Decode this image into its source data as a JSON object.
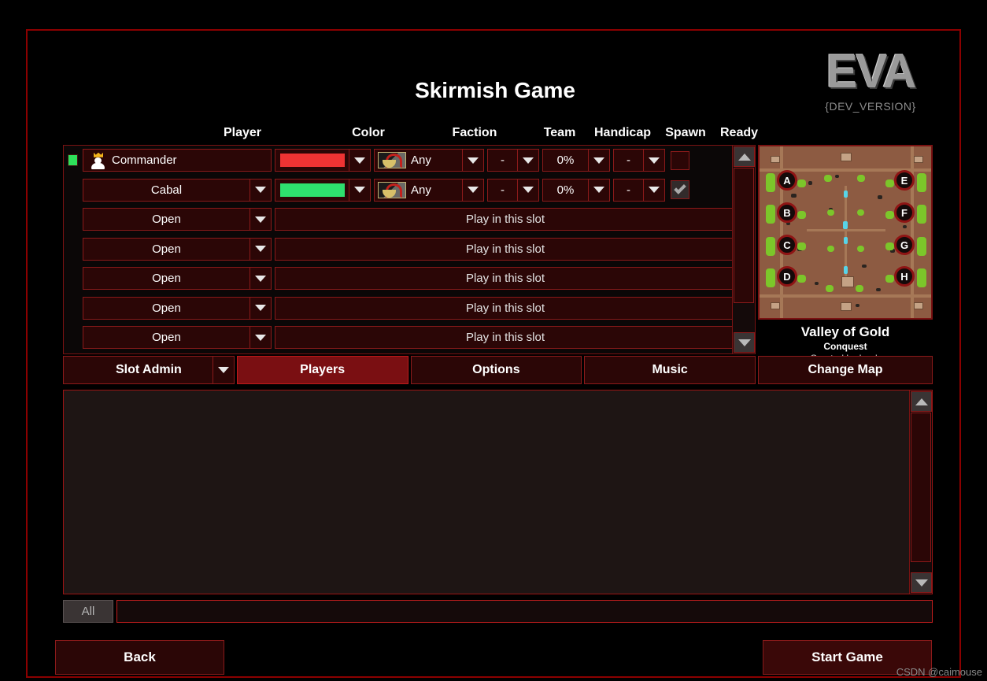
{
  "window": {
    "title": "Skirmish Game",
    "logo_text": "EVA",
    "version_tag": "{DEV_VERSION}",
    "watermark": "CSDN @caimouse"
  },
  "colors": {
    "frame_border": "#8b0000",
    "panel_bg": "#2b0606",
    "panel_border": "#8b1a1a",
    "accent_active": "#7a0f12",
    "player1_color": "#ee3333",
    "player2_color": "#2ee06e",
    "ping_ok": "#2ee05a"
  },
  "player_table": {
    "headers": [
      "Player",
      "Color",
      "Faction",
      "Team",
      "Handicap",
      "Spawn",
      "Ready"
    ],
    "rows": [
      {
        "type": "occupied",
        "ping": "online",
        "is_host": true,
        "avatar_icon": "crown-player-icon",
        "name": "Commander",
        "name_has_dropdown": false,
        "color": "#ee3333",
        "faction": "Any",
        "faction_icon": "faction-any-icon",
        "team": "-",
        "handicap": "0%",
        "spawn": "-",
        "ready": false
      },
      {
        "type": "occupied",
        "ping": "none",
        "is_host": false,
        "avatar_icon": "",
        "name": "Cabal",
        "name_has_dropdown": true,
        "color": "#2ee06e",
        "faction": "Any",
        "faction_icon": "faction-any-icon",
        "team": "-",
        "handicap": "0%",
        "spawn": "-",
        "ready": true
      },
      {
        "type": "open",
        "name": "Open",
        "action_label": "Play in this slot"
      },
      {
        "type": "open",
        "name": "Open",
        "action_label": "Play in this slot"
      },
      {
        "type": "open",
        "name": "Open",
        "action_label": "Play in this slot"
      },
      {
        "type": "open",
        "name": "Open",
        "action_label": "Play in this slot"
      },
      {
        "type": "open",
        "name": "Open",
        "action_label": "Play in this slot"
      }
    ]
  },
  "map": {
    "name": "Valley of Gold",
    "mode": "Conquest",
    "author": "Created by Irnub",
    "spawn_labels": [
      "A",
      "B",
      "C",
      "D",
      "E",
      "F",
      "G",
      "H"
    ],
    "change_map_label": "Change Map"
  },
  "tabs": {
    "slot_admin_label": "Slot Admin",
    "items": [
      {
        "label": "Players",
        "active": true
      },
      {
        "label": "Options",
        "active": false
      },
      {
        "label": "Music",
        "active": false
      }
    ]
  },
  "chat": {
    "scope_label": "All",
    "input_value": "",
    "placeholder": ""
  },
  "footer": {
    "back_label": "Back",
    "start_label": "Start Game"
  }
}
